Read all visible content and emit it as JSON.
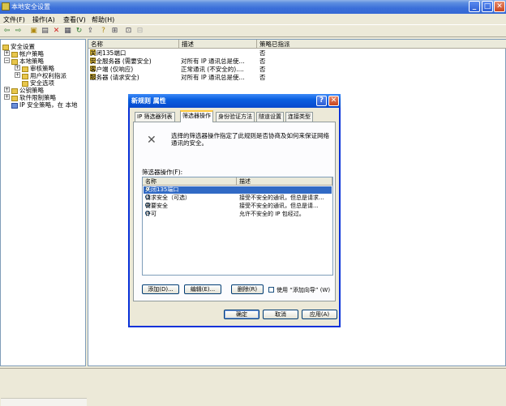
{
  "window": {
    "title": "本地安全设置"
  },
  "menu": [
    "文件(F)",
    "操作(A)",
    "查看(V)",
    "帮助(H)"
  ],
  "toolbar_icons": [
    "back-icon",
    "forward-icon",
    "up-folder-icon",
    "show-tree-icon",
    "delete-icon",
    "properties-icon",
    "refresh-icon",
    "export-icon",
    "help-icon",
    "add-policy-icon",
    "assign-icon",
    "unassign-icon"
  ],
  "tree": {
    "root": "安全设置",
    "items": [
      "帐户策略",
      "本地策略",
      "审核策略",
      "用户权利指派",
      "安全选项",
      "公钥策略",
      "软件限制策略",
      "IP 安全策略，在 本地"
    ]
  },
  "list": {
    "headers": [
      "名称",
      "描述",
      "策略已指派"
    ],
    "rows": [
      {
        "name": "关闭135端口",
        "desc": "",
        "assigned": "否"
      },
      {
        "name": "安全服务器 (需要安全)",
        "desc": "对所有 IP 通讯总是使...",
        "assigned": "否"
      },
      {
        "name": "客户端 (仅响应)",
        "desc": "正常通讯 (不安全的)....",
        "assigned": "否"
      },
      {
        "name": "服务器 (请求安全)",
        "desc": "对所有 IP 通讯总是使...",
        "assigned": "否"
      }
    ]
  },
  "dialog": {
    "title": "新规则 属性",
    "help_glyph": "?",
    "close_glyph": "✕",
    "tabs": [
      "IP 筛选器列表",
      "筛选器操作",
      "身份验证方法",
      "隧道设置",
      "连接类型"
    ],
    "active_tab": 1,
    "description": "选择的筛选器操作指定了此规则是否协商及如何来保证网络通讯的安全。",
    "filter_label": "筛选器操作(F):",
    "table_headers": [
      "名称",
      "描述"
    ],
    "filters": [
      {
        "name": "关闭135端口",
        "desc": "",
        "selected": true
      },
      {
        "name": "请求安全（可选）",
        "desc": "接受不安全的通讯，但总是请求...",
        "selected": false
      },
      {
        "name": "需要安全",
        "desc": "接受不安全的通讯，但总是请...",
        "selected": false
      },
      {
        "name": "许可",
        "desc": "允许不安全的 IP 包经过。",
        "selected": false
      }
    ],
    "add_button": "添加(D)...",
    "edit_button": "编辑(E)...",
    "remove_button": "删除(R)",
    "wizard_checkbox": "使用 “添加向导” (W)",
    "ok_button": "确定",
    "cancel_button": "取消",
    "apply_button": "应用(A)"
  }
}
